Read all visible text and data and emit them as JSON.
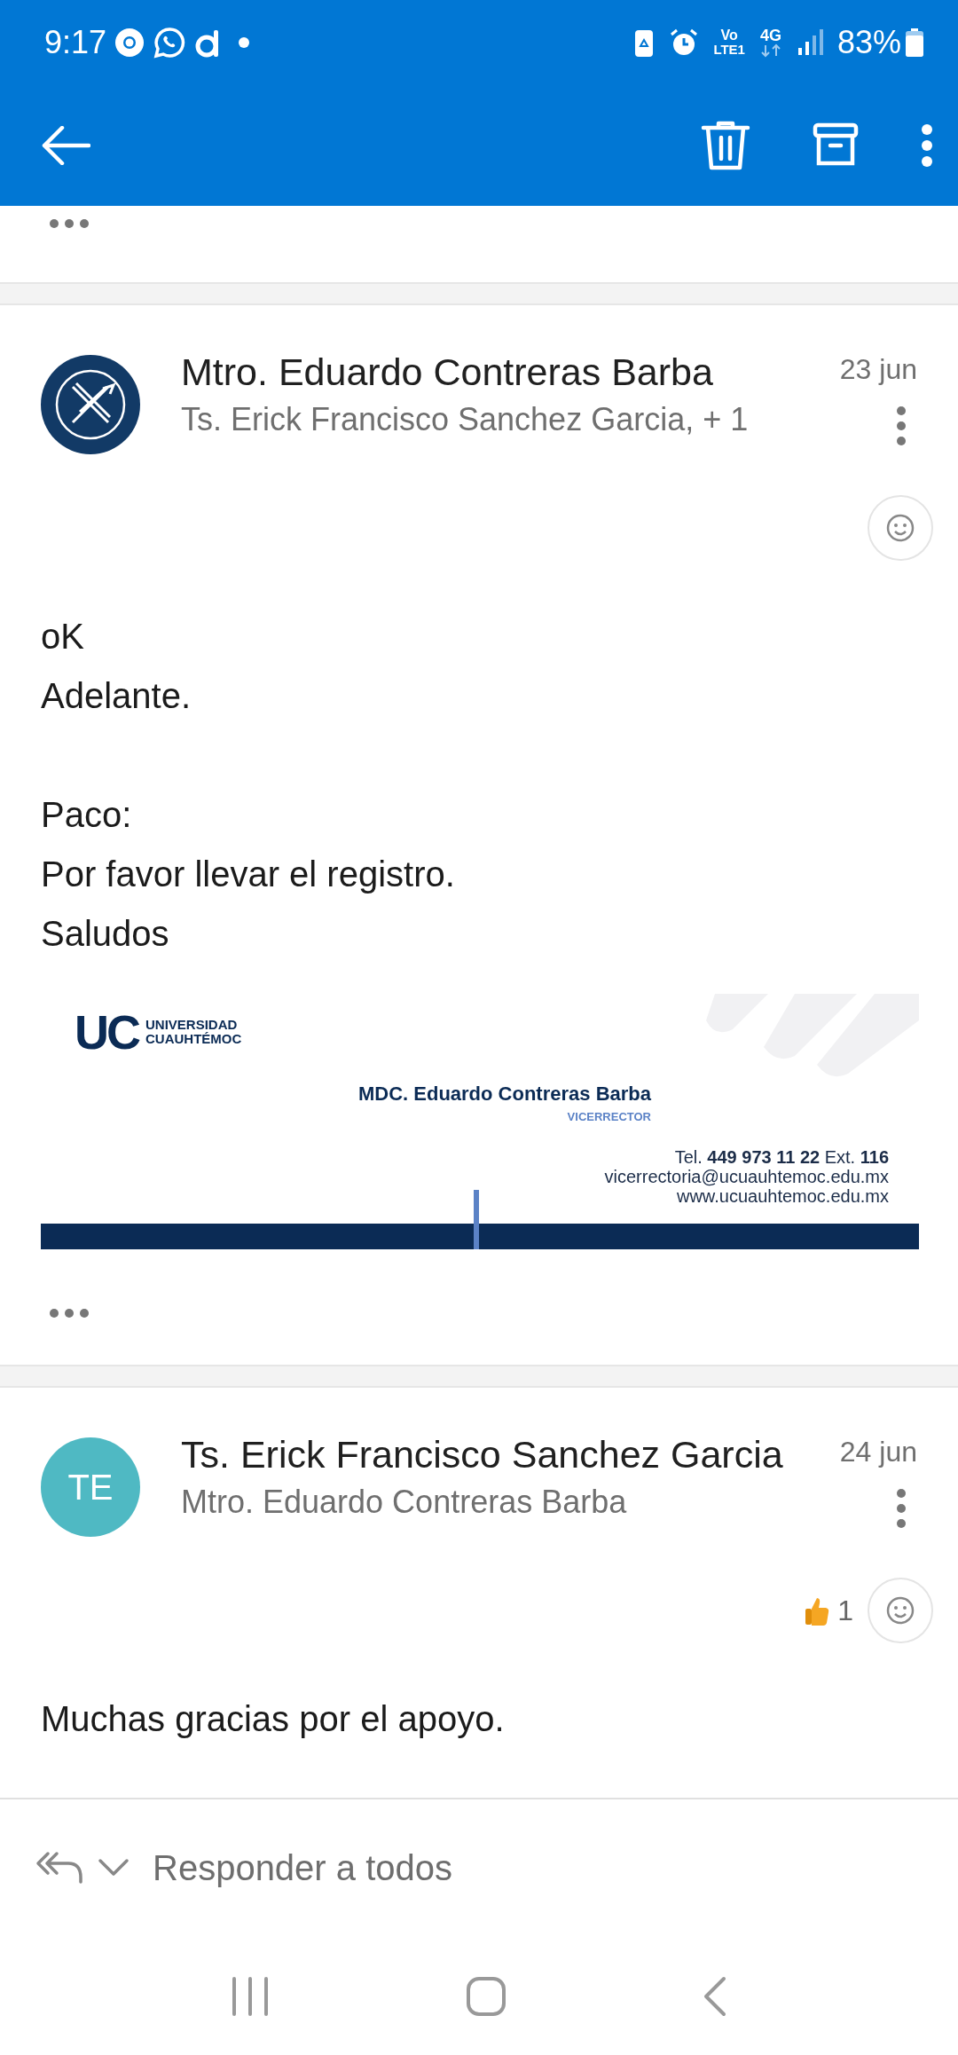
{
  "status_bar": {
    "time": "9:17",
    "volte_top": "Vo",
    "volte_bottom": "LTE1",
    "network": "4G",
    "battery": "83%"
  },
  "messages": [
    {
      "avatar": {
        "kind": "logo"
      },
      "sender": "Mtro. Eduardo Contreras Barba",
      "recipients": "Ts. Erick Francisco Sanchez Garcia, + 1",
      "date": "23 jun",
      "paragraphs": [
        [
          "oK",
          "Adelante."
        ],
        [
          "Paco:",
          "Por favor llevar el registro.",
          "Saludos"
        ]
      ],
      "signature": {
        "logo_letters": "UC",
        "logo_line1": "UNIVERSIDAD",
        "logo_line2": "CUAUHTÉMOC",
        "name": "MDC. Eduardo Contreras Barba",
        "title": "VICERRECTOR",
        "phone": "Tel. **449 973 11 22** Ext. **116**",
        "email": "vicerrectoria@ucuauhtemoc.edu.mx",
        "web": "www.ucuauhtemoc.edu.mx"
      },
      "show_more": true
    },
    {
      "avatar": {
        "kind": "initials",
        "initials": "TE",
        "color": "#4fb9c3"
      },
      "sender": "Ts. Erick Francisco Sanchez Garcia",
      "recipients": "Mtro. Eduardo Contreras Barba",
      "date": "24 jun",
      "reactions": [
        {
          "count": "1"
        }
      ],
      "paragraphs": [
        [
          "Muchas gracias por el apoyo."
        ]
      ],
      "show_more": false
    }
  ],
  "reply_bar": {
    "label": "Responder a todos"
  }
}
